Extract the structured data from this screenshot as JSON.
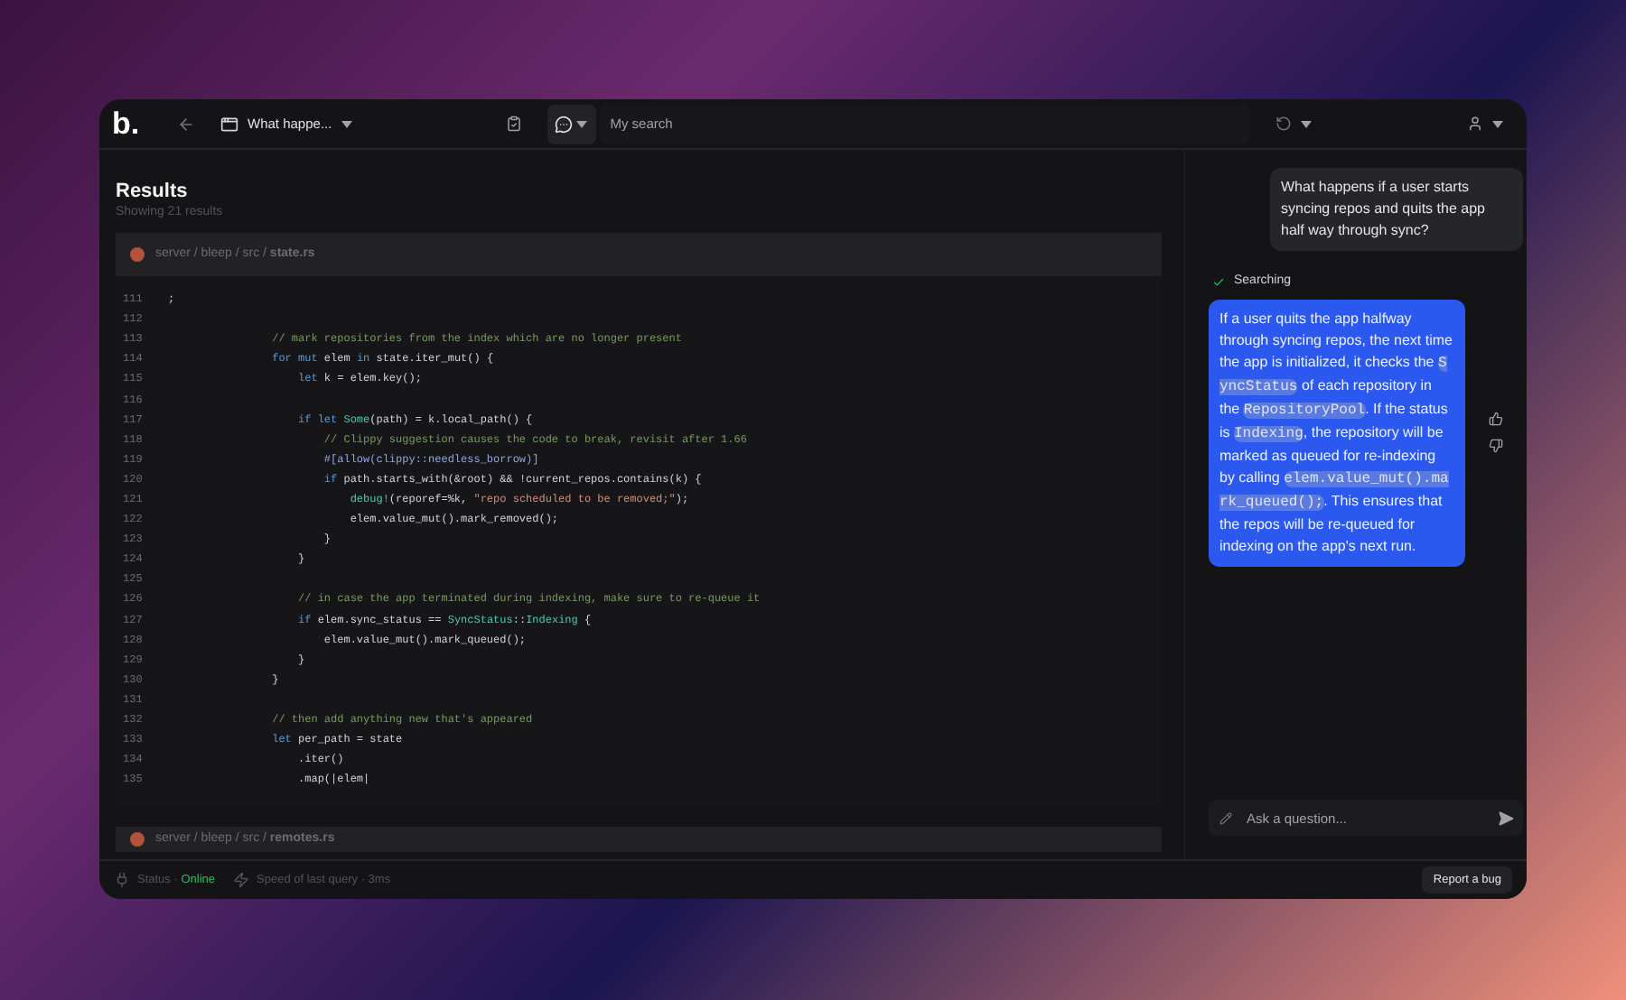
{
  "top_bar": {
    "logo": "b.",
    "tab_title": "What happe...",
    "search": {
      "placeholder": "My search"
    }
  },
  "results": {
    "title": "Results",
    "subtitle": "Showing 21 results",
    "files": [
      {
        "path": "server / bleep / src / **state.rs**",
        "lines": [
          {
            "number": "111",
            "tokens": [
              {
                "kind": "plain",
                "text": ";"
              }
            ]
          },
          {
            "number": "112"
          },
          {
            "number": "113",
            "tokens": [
              {
                "kind": "comment",
                "text": "                // mark repositories from the index which are no longer present"
              }
            ]
          },
          {
            "number": "114",
            "tokens": [
              {
                "kind": "keyword",
                "text": "                for"
              },
              {
                "kind": "keyword",
                "text": " mut"
              },
              {
                "kind": "plain",
                "text": " elem "
              },
              {
                "kind": "keyword",
                "text": "in"
              },
              {
                "kind": "plain",
                "text": " state.iter_mut() {"
              }
            ]
          },
          {
            "number": "115",
            "tokens": [
              {
                "kind": "keyword",
                "text": "                    let"
              },
              {
                "kind": "plain",
                "text": " k = elem.key();"
              }
            ]
          },
          {
            "number": "116"
          },
          {
            "number": "117",
            "tokens": [
              {
                "kind": "keyword",
                "text": "                    if"
              },
              {
                "kind": "keyword",
                "text": " let"
              },
              {
                "kind": "type",
                "text": " Some"
              },
              {
                "kind": "plain",
                "text": "(path) = k.local_path() {"
              }
            ]
          },
          {
            "number": "118",
            "tokens": [
              {
                "kind": "comment",
                "text": "                        // Clippy suggestion causes the code to break, revisit after 1.66"
              }
            ]
          },
          {
            "number": "119",
            "tokens": [
              {
                "kind": "attribute",
                "text": "                        #[allow(clippy::needless_borrow)]"
              }
            ]
          },
          {
            "number": "120",
            "tokens": [
              {
                "kind": "keyword",
                "text": "                        if"
              },
              {
                "kind": "plain",
                "text": " path.starts_with(&root) && !current_repos.contains(k) {"
              }
            ]
          },
          {
            "number": "121",
            "tokens": [
              {
                "kind": "macro",
                "text": "                            debug!"
              },
              {
                "kind": "plain",
                "text": "(reporef=%k, "
              },
              {
                "kind": "string",
                "text": "\"repo scheduled to be removed;\""
              },
              {
                "kind": "plain",
                "text": ");"
              }
            ]
          },
          {
            "number": "122",
            "tokens": [
              {
                "kind": "plain",
                "text": "                            elem.value_mut().mark_removed();"
              }
            ]
          },
          {
            "number": "123",
            "tokens": [
              {
                "kind": "plain",
                "text": "                        }"
              }
            ]
          },
          {
            "number": "124",
            "tokens": [
              {
                "kind": "plain",
                "text": "                    }"
              }
            ]
          },
          {
            "number": "125"
          },
          {
            "number": "126",
            "tokens": [
              {
                "kind": "comment",
                "text": "                    // in case the app terminated during indexing, make sure to re-queue it"
              }
            ]
          },
          {
            "number": "127",
            "tokens": [
              {
                "kind": "keyword",
                "text": "                    if"
              },
              {
                "kind": "plain",
                "text": " elem.sync_status == "
              },
              {
                "kind": "type",
                "text": "SyncStatus"
              },
              {
                "kind": "plain",
                "text": "::"
              },
              {
                "kind": "type",
                "text": "Indexing"
              },
              {
                "kind": "plain",
                "text": " {"
              }
            ]
          },
          {
            "number": "128",
            "tokens": [
              {
                "kind": "plain",
                "text": "                        elem.value_mut().mark_queued();"
              }
            ]
          },
          {
            "number": "129",
            "tokens": [
              {
                "kind": "plain",
                "text": "                    }"
              }
            ]
          },
          {
            "number": "130",
            "tokens": [
              {
                "kind": "plain",
                "text": "                }"
              }
            ]
          },
          {
            "number": "131"
          },
          {
            "number": "132",
            "tokens": [
              {
                "kind": "comment",
                "text": "                // then add anything new that's appeared"
              }
            ]
          },
          {
            "number": "133",
            "tokens": [
              {
                "kind": "keyword",
                "text": "                let"
              },
              {
                "kind": "plain",
                "text": " per_path = state"
              }
            ]
          },
          {
            "number": "134",
            "tokens": [
              {
                "kind": "plain",
                "text": "                    .iter()"
              }
            ]
          },
          {
            "number": "135",
            "tokens": [
              {
                "kind": "plain",
                "text": "                    .map(|elem|"
              }
            ]
          }
        ]
      },
      {
        "path": "server / bleep / src / **remotes.rs**"
      }
    ]
  },
  "chat": {
    "question": "What happens if a user starts syncing repos and quits the app half way through sync?",
    "status": {
      "label": "Searching",
      "done": true
    },
    "answer": {
      "segments": [
        {
          "kind": "text",
          "text": "If a user quits the app halfway through syncing repos, the next time the app is initialized, it checks the "
        },
        {
          "kind": "code",
          "text": "SyncStatus"
        },
        {
          "kind": "text",
          "text": " of each repository in the "
        },
        {
          "kind": "code",
          "text": "RepositoryPool"
        },
        {
          "kind": "text",
          "text": ". If the status is "
        },
        {
          "kind": "code",
          "text": "Indexing"
        },
        {
          "kind": "text",
          "text": ", the repository will be marked as queued for re-indexing by calling "
        },
        {
          "kind": "code",
          "text": "elem.value_mut().mark_queued();"
        },
        {
          "kind": "text",
          "text": ". This ensures that the repos will be re-queued for indexing on the app's next run."
        }
      ]
    },
    "input": {
      "placeholder": "Ask a question..."
    }
  },
  "status_bar": {
    "status_label": "Status · ",
    "status_value": "Online",
    "online": true,
    "speed": "Speed of last query · 3ms",
    "report_button": "Report a bug"
  }
}
